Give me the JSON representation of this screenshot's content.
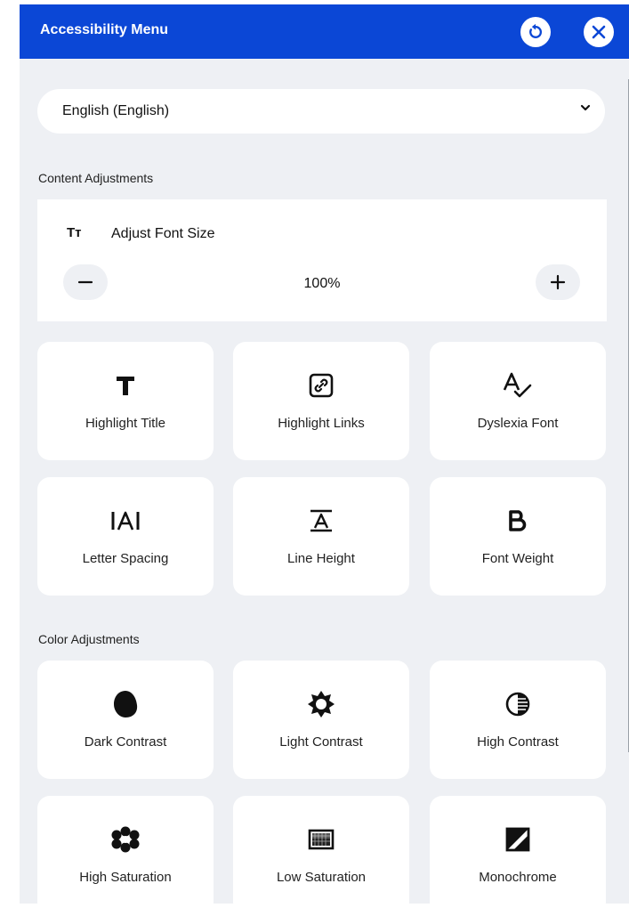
{
  "header": {
    "title": "Accessibility Menu"
  },
  "language": {
    "selected": "English (English)"
  },
  "sections": {
    "content": "Content Adjustments",
    "color": "Color Adjustments"
  },
  "font_size": {
    "label": "Adjust Font Size",
    "value": "100%",
    "icon_text": "Tт"
  },
  "content_cards": [
    {
      "label": "Highlight Title",
      "icon": "title-icon"
    },
    {
      "label": "Highlight Links",
      "icon": "link-icon"
    },
    {
      "label": "Dyslexia Font",
      "icon": "dyslexia-font-icon"
    },
    {
      "label": "Letter Spacing",
      "icon": "letter-spacing-icon"
    },
    {
      "label": "Line Height",
      "icon": "line-height-icon"
    },
    {
      "label": "Font Weight",
      "icon": "bold-icon"
    }
  ],
  "color_cards": [
    {
      "label": "Dark Contrast",
      "icon": "dark-contrast-icon"
    },
    {
      "label": "Light Contrast",
      "icon": "sun-icon"
    },
    {
      "label": "High Contrast",
      "icon": "high-contrast-icon"
    },
    {
      "label": "High Saturation",
      "icon": "flower-icon"
    },
    {
      "label": "Low Saturation",
      "icon": "low-saturation-icon"
    },
    {
      "label": "Monochrome",
      "icon": "monochrome-icon"
    }
  ],
  "colors": {
    "header": "#0b47d6",
    "panel_bg": "#eef0f4",
    "card_bg": "#ffffff"
  }
}
